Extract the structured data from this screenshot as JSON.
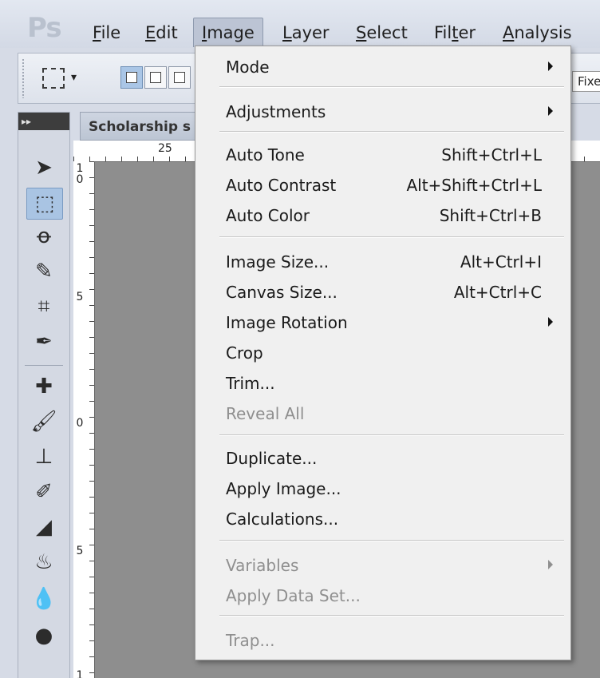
{
  "app": {
    "logo": "Ps"
  },
  "menubar": {
    "items": [
      {
        "label": "File",
        "mnemonic": "F",
        "rest": "ile"
      },
      {
        "label": "Edit",
        "mnemonic": "E",
        "rest": "dit"
      },
      {
        "label": "Image",
        "mnemonic": "I",
        "rest": "mage"
      },
      {
        "label": "Layer",
        "mnemonic": "L",
        "rest": "ayer"
      },
      {
        "label": "Select",
        "mnemonic": "S",
        "rest": "elect"
      },
      {
        "label": "Filter",
        "pre": "Fil",
        "mnemonic": "t",
        "rest": "er"
      },
      {
        "label": "Analysis",
        "mnemonic": "A",
        "rest": "nalysis"
      }
    ]
  },
  "options": {
    "fixed_value": "Fixe"
  },
  "document": {
    "tab_title": "Scholarship s",
    "hruler_labels": [
      "25"
    ],
    "vruler_labels": [
      "1\n0",
      "5",
      "0",
      "5",
      "1"
    ]
  },
  "image_menu": {
    "items": [
      {
        "label": "Mode",
        "shortcut": "",
        "submenu": true,
        "disabled": false
      },
      {
        "label": "Adjustments",
        "shortcut": "",
        "submenu": true,
        "disabled": false
      },
      {
        "label": "Auto Tone",
        "shortcut": "Shift+Ctrl+L",
        "submenu": false,
        "disabled": false
      },
      {
        "label": "Auto Contrast",
        "shortcut": "Alt+Shift+Ctrl+L",
        "submenu": false,
        "disabled": false
      },
      {
        "label": "Auto Color",
        "shortcut": "Shift+Ctrl+B",
        "submenu": false,
        "disabled": false
      },
      {
        "label": "Image Size...",
        "shortcut": "Alt+Ctrl+I",
        "submenu": false,
        "disabled": false
      },
      {
        "label": "Canvas Size...",
        "shortcut": "Alt+Ctrl+C",
        "submenu": false,
        "disabled": false
      },
      {
        "label": "Image Rotation",
        "shortcut": "",
        "submenu": true,
        "disabled": false
      },
      {
        "label": "Crop",
        "shortcut": "",
        "submenu": false,
        "disabled": false
      },
      {
        "label": "Trim...",
        "shortcut": "",
        "submenu": false,
        "disabled": false
      },
      {
        "label": "Reveal All",
        "shortcut": "",
        "submenu": false,
        "disabled": true
      },
      {
        "label": "Duplicate...",
        "shortcut": "",
        "submenu": false,
        "disabled": false
      },
      {
        "label": "Apply Image...",
        "shortcut": "",
        "submenu": false,
        "disabled": false
      },
      {
        "label": "Calculations...",
        "shortcut": "",
        "submenu": false,
        "disabled": false
      },
      {
        "label": "Variables",
        "shortcut": "",
        "submenu": true,
        "disabled": true
      },
      {
        "label": "Apply Data Set...",
        "shortcut": "",
        "submenu": false,
        "disabled": true
      },
      {
        "label": "Trap...",
        "shortcut": "",
        "submenu": false,
        "disabled": true
      }
    ]
  },
  "tools": [
    "move-tool-icon",
    "rectangular-marquee-tool-icon",
    "lasso-tool-icon",
    "quick-selection-tool-icon",
    "crop-tool-icon",
    "eyedropper-tool-icon",
    "spot-healing-brush-icon",
    "brush-tool-icon",
    "clone-stamp-tool-icon",
    "history-brush-icon",
    "eraser-tool-icon",
    "paint-bucket-icon",
    "blur-tool-icon",
    "dodge-tool-icon"
  ],
  "colors": {
    "menu_bg": "#f0f0f0",
    "disabled_text": "#8f8f8f",
    "active_tool": "#a9c4e3"
  }
}
